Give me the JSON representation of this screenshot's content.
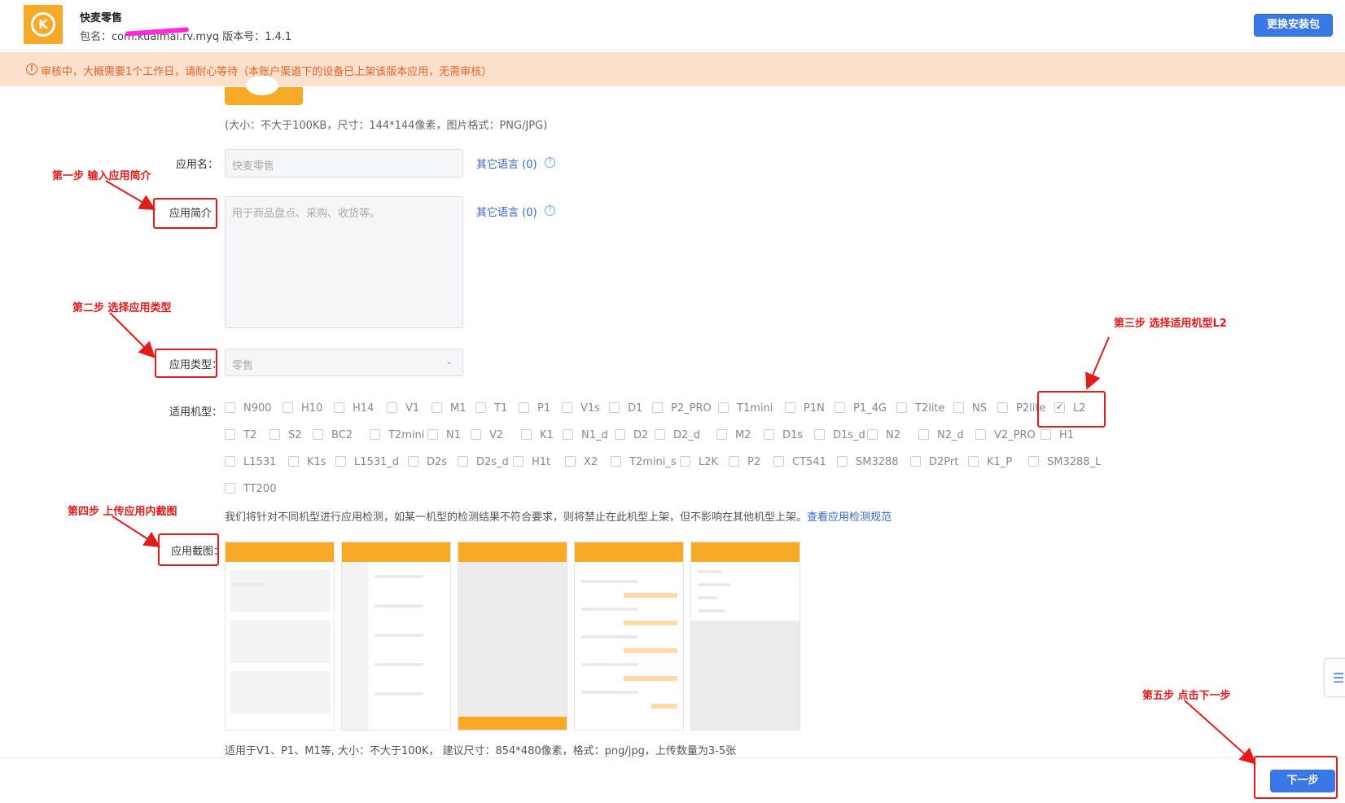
{
  "header": {
    "app_name": "快麦零售",
    "package_line": "包名：com.kuaimai.rv.myq 版本号：1.4.1",
    "replace_button": "更换安装包",
    "logo_glyph": "K"
  },
  "banner": {
    "icon": "!",
    "text": "审核中，大概需要1个工作日，请耐心等待（本账户渠道下的设备已上架该版本应用，无需审核）"
  },
  "icon_hint": "(大小：不大于100KB，尺寸：144*144像素，图片格式：PNG/JPG)",
  "form": {
    "app_name_label": "应用名：",
    "app_name_value": "快麦零售",
    "other_lang_1": "其它语言 (0)",
    "intro_label": "应用简介",
    "intro_placeholder": "用于商品盘点、采购、收货等。",
    "other_lang_2": "其它语言 (0)",
    "help_glyph": "?",
    "type_label": "应用类型：",
    "type_value": "零售",
    "models_label": "适用机型：",
    "screens_label": "应用截图：",
    "select_arrow": "⌄"
  },
  "models": [
    [
      "N900",
      "H10",
      "H14",
      "V1",
      "M1",
      "T1",
      "P1",
      "V1s",
      "D1",
      "P2_PRO",
      "T1mini",
      "P1N",
      "P1_4G",
      "T2lite",
      "NS",
      "P2lite",
      "L2"
    ],
    [
      "T2",
      "S2",
      "BC2",
      "T2mini",
      "N1",
      "V2",
      "K1",
      "N1_d",
      "D2",
      "D2_d",
      "M2",
      "D1s",
      "D1s_d",
      "N2",
      "N2_d",
      "V2_PRO",
      "H1"
    ],
    [
      "L1531",
      "K1s",
      "L1531_d",
      "D2s",
      "D2s_d",
      "H1t",
      "X2",
      "T2mini_s",
      "L2K",
      "P2",
      "CT541",
      "SM3288",
      "D2Prt",
      "K1_P",
      "SM3288_L"
    ],
    [
      "TT200"
    ]
  ],
  "checked_model": "L2",
  "model_note": "我们将针对不同机型进行应用检测，如某一机型的检测结果不符合要求，则将禁止在此机型上架，但不影响在其他机型上架。",
  "model_note_link": "查看应用检测规范",
  "screenshot_hint": "适用于V1、P1、M1等, 大小：不大于100K，  建议尺寸：854*480像素，格式：png/jpg，上传数量为3-5张",
  "next_button": "下一步",
  "side_tab_icon": "☰",
  "annotations": {
    "step1": "第一步  输入应用简介",
    "step2": "第二步  选择应用类型",
    "step3": "第三步  选择适用机型L2",
    "step4": "第四步  上传应用内截图",
    "step5": "第五步  点击下一步"
  },
  "colors": {
    "primary": "#3b78e7",
    "brand_orange": "#f7a928",
    "banner_bg": "#fde1cc",
    "banner_text": "#e8612c",
    "annotation_red": "#e21b1b"
  }
}
